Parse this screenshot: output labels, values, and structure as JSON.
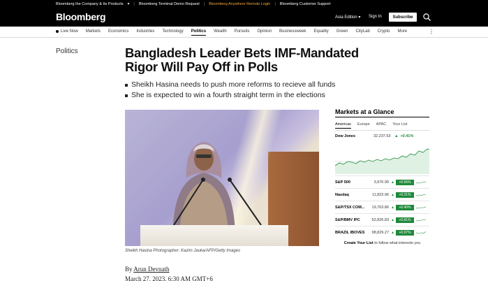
{
  "topbar": {
    "company": "Bloomberg the Company & Its Products",
    "terminal_demo": "Bloomberg Terminal Demo Request",
    "anywhere": "Bloomberg Anywhere Remote Login",
    "support": "Bloomberg Customer Support"
  },
  "header": {
    "logo": "Bloomberg",
    "edition": "Asia Edition",
    "signin": "Sign In",
    "subscribe": "Subscribe"
  },
  "nav": {
    "items": [
      "Live Now",
      "Markets",
      "Economics",
      "Industries",
      "Technology",
      "Politics",
      "Wealth",
      "Pursuits",
      "Opinion",
      "Businessweek",
      "Equality",
      "Green",
      "CityLab",
      "Crypto",
      "More"
    ],
    "active": "Politics"
  },
  "article": {
    "section": "Politics",
    "headline": "Bangladesh Leader Bets IMF-Mandated Rigor Will Pay Off in Polls",
    "bullets": [
      "Sheikh Hasina needs to push more reforms to recieve all funds",
      "She is expected to win a fourth straight term in the elections"
    ],
    "caption": "Sheikh Hasina Photographer: Kazim Jauka/AFP/Getty Images",
    "by": "By",
    "author": "Arun Devnath",
    "date": "March 27, 2023, 6:30 AM GMT+6"
  },
  "markets": {
    "title": "Markets at a Glance",
    "tabs": [
      "Americas",
      "Europe",
      "APAC",
      "Your List"
    ],
    "active_tab": "Americas",
    "dow": {
      "name": "Dow Jones",
      "value": "32,237.53",
      "change": "+0.41%"
    },
    "rows": [
      {
        "name": "S&P 500",
        "value": "3,970.99",
        "change": "+0.56%"
      },
      {
        "name": "Nasdaq",
        "value": "11,823.96",
        "change": "+0.31%"
      },
      {
        "name": "S&P/TSX COM...",
        "value": "19,763.86",
        "change": "+0.40%"
      },
      {
        "name": "S&P/BMV IPC",
        "value": "52,826.83",
        "change": "+0.81%"
      },
      {
        "name": "BRAZIL IBOVES...",
        "value": "98,829.27",
        "change": "+0.97%"
      }
    ],
    "create_list_bold": "Create Your List",
    "create_list_rest": "to follow what interests you",
    "accent_color": "#1f8a3a"
  }
}
